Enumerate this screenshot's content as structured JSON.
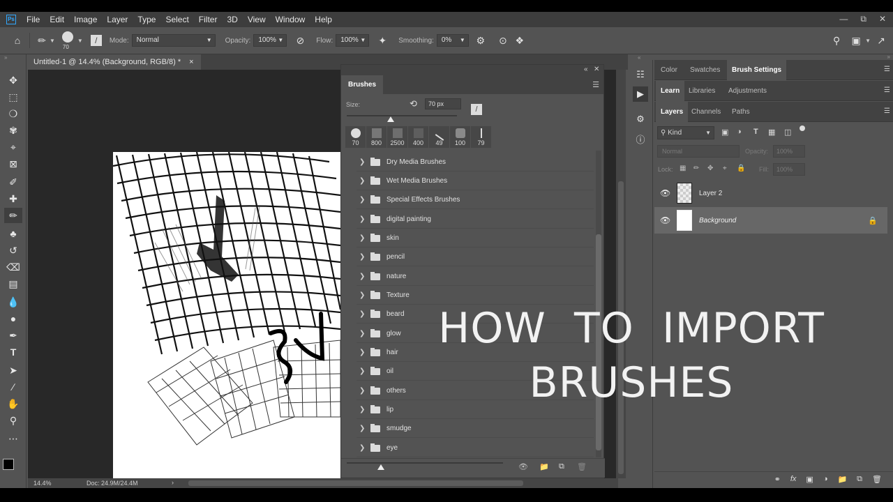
{
  "app": {
    "logo": "Ps"
  },
  "menu": [
    "File",
    "Edit",
    "Image",
    "Layer",
    "Type",
    "Select",
    "Filter",
    "3D",
    "View",
    "Window",
    "Help"
  ],
  "options": {
    "brush_size": "70",
    "mode_label": "Mode:",
    "mode_value": "Normal",
    "opacity_label": "Opacity:",
    "opacity_value": "100%",
    "flow_label": "Flow:",
    "flow_value": "100%",
    "smoothing_label": "Smoothing:",
    "smoothing_value": "0%"
  },
  "document": {
    "tab_title": "Untitled-1 @ 14.4% (Background, RGB/8) *",
    "close": "×"
  },
  "status": {
    "zoom": "14.4%",
    "doc": "Doc: 24.9M/24.4M"
  },
  "brushes_panel": {
    "title": "Brushes",
    "size_label": "Size:",
    "size_value": "70 px",
    "size_fraction": 0.12,
    "presets": [
      "70",
      "800",
      "2500",
      "400",
      "49",
      "100",
      "79"
    ],
    "folders": [
      "Dry Media Brushes",
      "Wet Media Brushes",
      "Special Effects Brushes",
      "digital painting",
      "skin",
      "pencil",
      "nature",
      "Texture",
      "beard",
      "glow",
      "hair",
      "oil",
      "others",
      "lip",
      "smudge",
      "eye"
    ]
  },
  "right_panels": {
    "tabs_row1": [
      "Color",
      "Swatches",
      "Brush Settings"
    ],
    "tabs_row2": [
      "Learn",
      "Libraries",
      "Adjustments"
    ],
    "tabs_row3": [
      "Layers",
      "Channels",
      "Paths"
    ],
    "kind_label": "Kind",
    "blend_mode": "Normal",
    "opacity_label": "Opacity:",
    "opacity_value": "100%",
    "lock_label": "Lock:",
    "fill_label": "Fill:",
    "fill_value": "100%",
    "layers": [
      "Layer 2",
      "Background"
    ]
  },
  "overlay": {
    "line1": "HOW  TO  IMPORT",
    "line2": "BRUSHES"
  }
}
